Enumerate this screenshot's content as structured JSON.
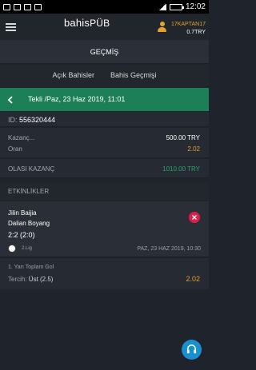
{
  "status_bar": {
    "time": "12:02"
  },
  "header": {
    "logo_main": "bahis",
    "logo_accent": "PÜB",
    "username": "17KAPTAN17",
    "balance": "0.7TRY"
  },
  "page": {
    "title": "GEÇMİŞ"
  },
  "tabs": [
    {
      "label": "Açık Bahisler"
    },
    {
      "label": "Bahis Geçmişi"
    }
  ],
  "bet": {
    "header_title": "Tekli /Paz, 23 Haz 2019, 11:01",
    "id_label": "ID:",
    "id_value": "556320444",
    "amount_label": "Kazanç...",
    "amount_value": "500.00 TRY",
    "odds_label": "Oran",
    "odds_value": "2.02",
    "potential_win_label": "OLASI KAZANÇ",
    "potential_win_value": "1010.00 TRY"
  },
  "events_section": {
    "title": "ETKİNLİKLER"
  },
  "event": {
    "home": "Jilin Baijia",
    "away": "Dalian Boyang",
    "score": "2:2 (2:0)",
    "league": "2.Lig",
    "date": "PAZ, 23 HAZ 2019, 10:30",
    "market": "1. Yarı Toplam Gol",
    "choice_label": "Tercih:",
    "choice_value": "Üst (2.5)",
    "choice_odds": "2.02"
  },
  "colors": {
    "accent_green": "#1d7f58",
    "odds_orange": "#e0a22a",
    "win_green": "#2ba36a",
    "remove_red": "#d81f4a",
    "support_blue": "#1a8fd0"
  }
}
